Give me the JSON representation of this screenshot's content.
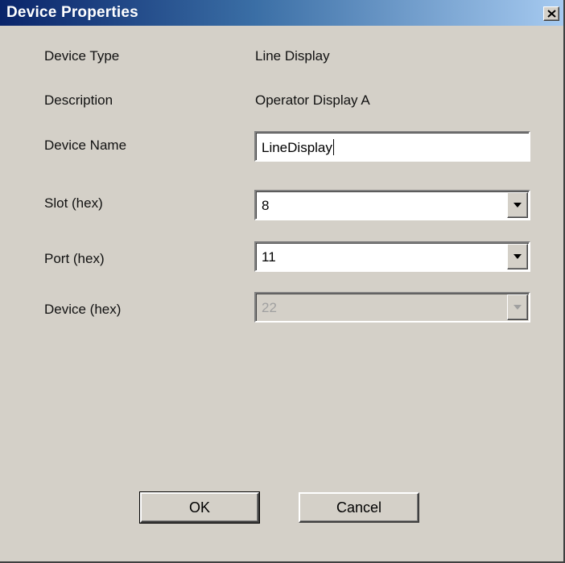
{
  "window": {
    "title": "Device Properties",
    "close_glyph": "×"
  },
  "fields": {
    "device_type": {
      "label": "Device Type",
      "value": "Line Display"
    },
    "description": {
      "label": "Description",
      "value": "Operator Display A"
    },
    "device_name": {
      "label": "Device Name",
      "value": "LineDisplay"
    },
    "slot": {
      "label": "Slot (hex)",
      "value": "8"
    },
    "port": {
      "label": "Port (hex)",
      "value": "11"
    },
    "device": {
      "label": "Device (hex)",
      "value": "22",
      "disabled": true
    }
  },
  "buttons": {
    "ok": "OK",
    "cancel": "Cancel"
  },
  "colors": {
    "dialog_bg": "#d4d0c8",
    "title_gradient_start": "#0a246a",
    "title_gradient_end": "#a6caf0",
    "disabled_text": "#a0a0a0"
  },
  "icons": {
    "close": "close-icon",
    "dropdown": "chevron-down-icon"
  }
}
